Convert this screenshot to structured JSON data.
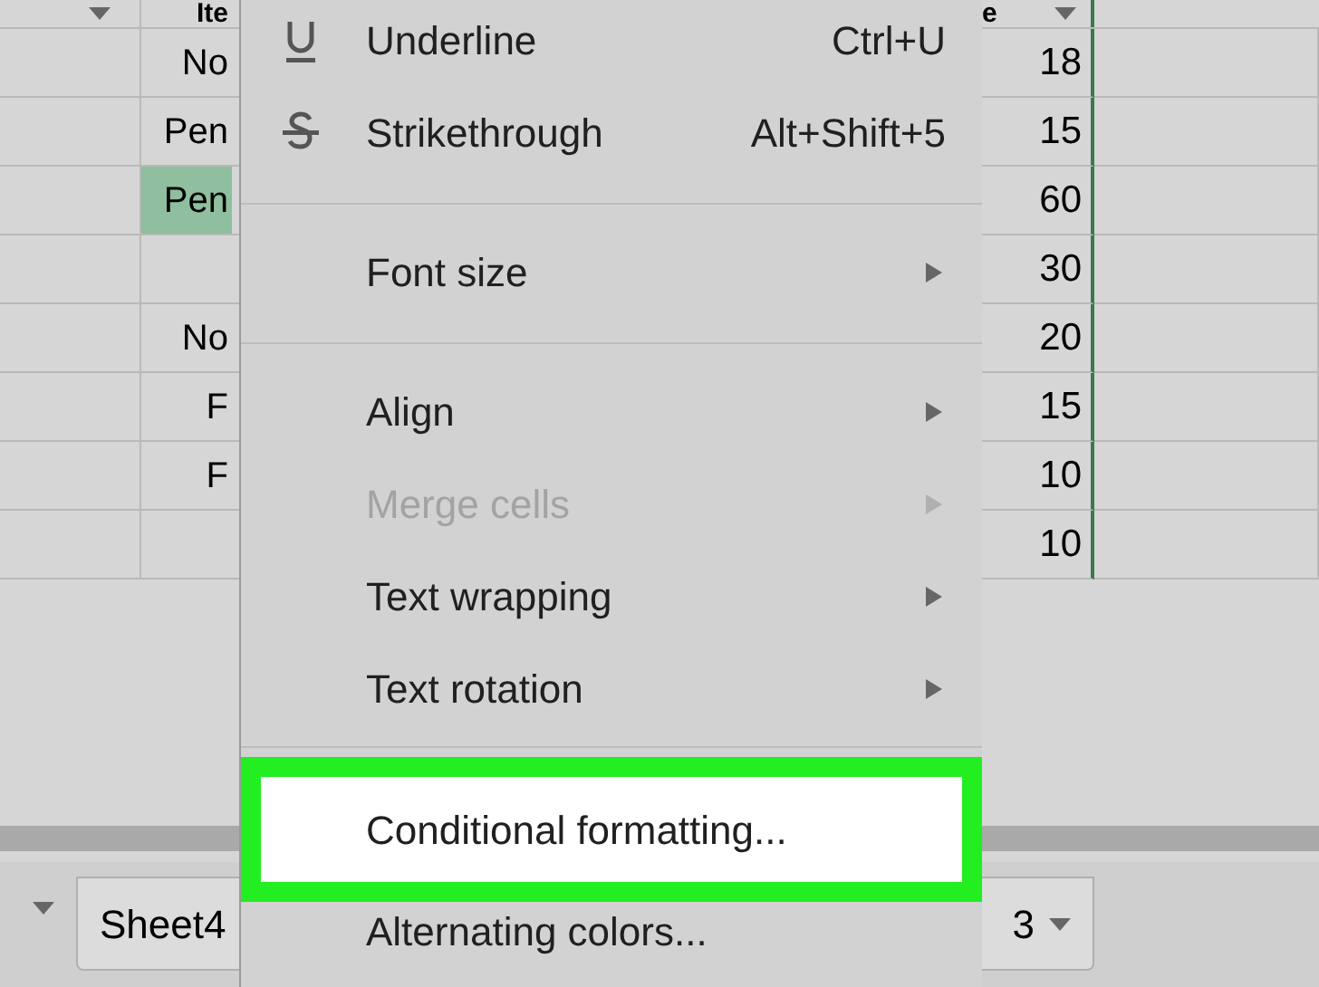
{
  "sheet": {
    "header": {
      "column_2": "Ite",
      "column_4": "e"
    },
    "rows": [
      {
        "column_2": "No",
        "column_4": "18",
        "selected": false
      },
      {
        "column_2": "Pen",
        "column_4": "15",
        "selected": false
      },
      {
        "column_2": "Pen",
        "column_4": "60",
        "selected": true
      },
      {
        "column_2": "",
        "column_4": "30",
        "selected": false
      },
      {
        "column_2": "No",
        "column_4": "20",
        "selected": false
      },
      {
        "column_2": "F",
        "column_4": "15",
        "selected": false
      },
      {
        "column_2": "F",
        "column_4": "10",
        "selected": false
      },
      {
        "column_2": "",
        "column_4": "10",
        "selected": false
      }
    ]
  },
  "menu": {
    "items": [
      {
        "kind": "item",
        "label": "Underline",
        "shortcut": "Ctrl+U",
        "disabled": false,
        "submenu": false,
        "highlighted": false
      },
      {
        "kind": "item",
        "label": "Strikethrough",
        "shortcut": "Alt+Shift+5",
        "disabled": false,
        "submenu": false,
        "highlighted": false
      },
      {
        "kind": "divider"
      },
      {
        "kind": "item",
        "label": "Font size",
        "disabled": false,
        "submenu": true,
        "highlighted": false
      },
      {
        "kind": "divider"
      },
      {
        "kind": "item",
        "label": "Align",
        "disabled": false,
        "submenu": true,
        "highlighted": false
      },
      {
        "kind": "item",
        "label": "Merge cells",
        "disabled": true,
        "submenu": true,
        "highlighted": false
      },
      {
        "kind": "item",
        "label": "Text wrapping",
        "disabled": false,
        "submenu": true,
        "highlighted": false
      },
      {
        "kind": "item",
        "label": "Text rotation",
        "disabled": false,
        "submenu": true,
        "highlighted": false
      },
      {
        "kind": "divider"
      },
      {
        "kind": "item",
        "label": "Conditional formatting...",
        "disabled": false,
        "submenu": false,
        "highlighted": true
      },
      {
        "kind": "item",
        "label": "Alternating colors...",
        "disabled": false,
        "submenu": false,
        "highlighted": false
      }
    ]
  },
  "sheet_tabs": [
    {
      "label": "Sheet4"
    },
    {
      "label": "3"
    }
  ]
}
